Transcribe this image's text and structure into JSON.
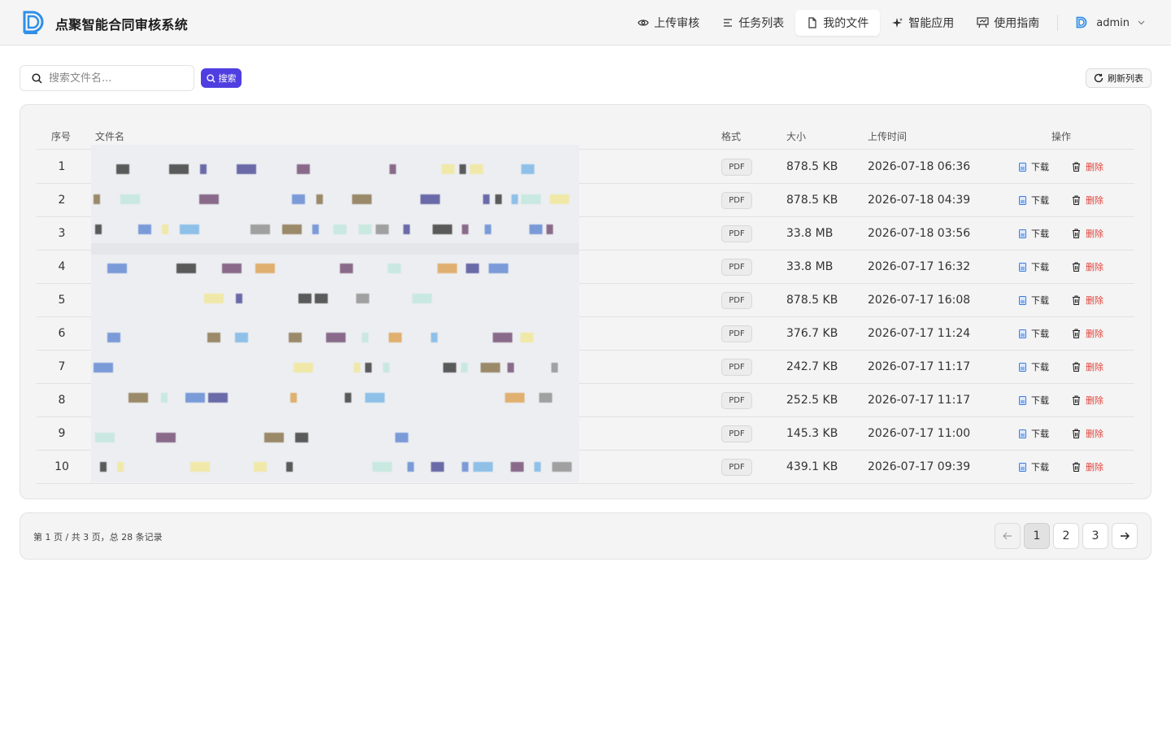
{
  "header": {
    "app_title": "点聚智能合同审核系统",
    "nav": [
      {
        "label": "上传审核",
        "icon": "eye-icon"
      },
      {
        "label": "任务列表",
        "icon": "list-icon"
      },
      {
        "label": "我的文件",
        "icon": "file-icon",
        "active": true
      },
      {
        "label": "智能应用",
        "icon": "sparkle-icon"
      },
      {
        "label": "使用指南",
        "icon": "guide-icon"
      }
    ],
    "user": {
      "name": "admin"
    }
  },
  "toolbar": {
    "search_placeholder": "搜索文件名...",
    "search_label": "搜索",
    "refresh_label": "刷新列表"
  },
  "table": {
    "headers": {
      "index": "序号",
      "name": "文件名",
      "format": "格式",
      "size": "大小",
      "time": "上传时间",
      "actions": "操作"
    },
    "download_label": "下载",
    "delete_label": "删除",
    "rows": [
      {
        "index": "1",
        "name": "",
        "format": "PDF",
        "size": "878.5 KB",
        "time": "2026-07-18 06:36"
      },
      {
        "index": "2",
        "name": "",
        "format": "PDF",
        "size": "878.5 KB",
        "time": "2026-07-18 04:39"
      },
      {
        "index": "3",
        "name": "",
        "format": "PDF",
        "size": "33.8 MB",
        "time": "2026-07-18 03:56"
      },
      {
        "index": "4",
        "name": "",
        "format": "PDF",
        "size": "33.8 MB",
        "time": "2026-07-17 16:32"
      },
      {
        "index": "5",
        "name": "",
        "format": "PDF",
        "size": "878.5 KB",
        "time": "2026-07-17 16:08"
      },
      {
        "index": "6",
        "name": "",
        "format": "PDF",
        "size": "376.7 KB",
        "time": "2026-07-17 11:24"
      },
      {
        "index": "7",
        "name": "",
        "format": "PDF",
        "size": "242.7 KB",
        "time": "2026-07-17 11:17"
      },
      {
        "index": "8",
        "name": "",
        "format": "PDF",
        "size": "252.5 KB",
        "time": "2026-07-17 11:17"
      },
      {
        "index": "9",
        "name": "",
        "format": "PDF",
        "size": "145.3 KB",
        "time": "2026-07-17 11:00"
      },
      {
        "index": "10",
        "name": "",
        "format": "PDF",
        "size": "439.1 KB",
        "time": "2026-07-17 09:39"
      }
    ]
  },
  "pagination": {
    "info": "第 1 页 / 共 3 页，总 28 条记录",
    "pages": [
      "1",
      "2",
      "3"
    ],
    "current": "1"
  },
  "colors": {
    "accent": "#4f3fe0",
    "danger": "#e0443c",
    "logo": "#2f8fe8"
  }
}
